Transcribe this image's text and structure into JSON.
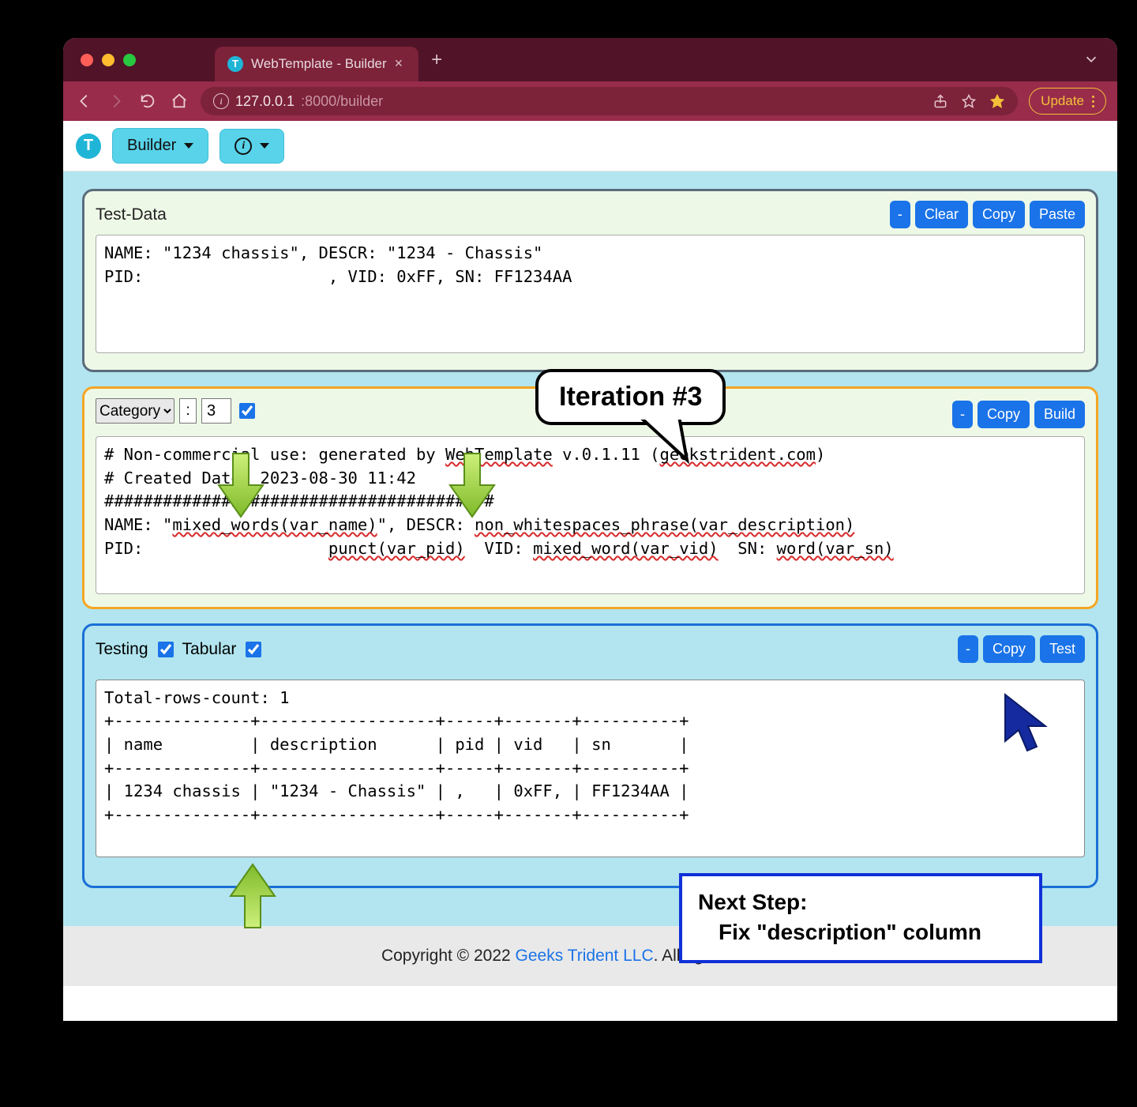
{
  "browser": {
    "tab_title": "WebTemplate - Builder",
    "url_host": "127.0.0.1",
    "url_port_path": ":8000/builder",
    "update_label": "Update"
  },
  "app_toolbar": {
    "builder_label": "Builder"
  },
  "panels": {
    "testdata": {
      "title": "Test-Data",
      "btn_minus": "-",
      "btn_clear": "Clear",
      "btn_copy": "Copy",
      "btn_paste": "Paste",
      "content": "NAME: \"1234 chassis\", DESCR: \"1234 - Chassis\"\nPID:                   , VID: 0xFF, SN: FF1234AA"
    },
    "template": {
      "category_selected": "Category",
      "colon": ":",
      "index": "3",
      "btn_minus": "-",
      "btn_copy": "Copy",
      "btn_build": "Build",
      "line1_a": "# Non-commercial use: generated by ",
      "line1_b": "WebTemplate",
      "line1_c": " v.0.1.11 (",
      "line1_d": "geekstrident.com",
      "line1_e": ")",
      "line2": "# Created Date: 2023-08-30 11:42",
      "line3": "########################################",
      "line4_a": "NAME: \"",
      "line4_b": "mixed_words(var_name)",
      "line4_c": "\", DESCR: ",
      "line4_d": "non_whitespaces_phrase(var_description)",
      "line5_a": "PID:                   ",
      "line5_b": "punct(var_pid)",
      "line5_c": "  VID: ",
      "line5_d": "mixed_word(var_vid)",
      "line5_e": "  SN: ",
      "line5_f": "word(var_sn)"
    },
    "testing": {
      "label_testing": "Testing",
      "label_tabular": "Tabular",
      "btn_minus": "-",
      "btn_copy": "Copy",
      "btn_test": "Test",
      "output": "Total-rows-count: 1\n+--------------+------------------+-----+-------+----------+\n| name         | description      | pid | vid   | sn       |\n+--------------+------------------+-----+-------+----------+\n| 1234 chassis | \"1234 - Chassis\" | ,   | 0xFF, | FF1234AA |\n+--------------+------------------+-----+-------+----------+"
    }
  },
  "annotations": {
    "iteration": "Iteration #3",
    "next_step_l1": "Next Step:",
    "next_step_l2": "Fix \"description\" column"
  },
  "footer": {
    "prefix": "Copyright © 2022 ",
    "link": "Geeks Trident LLC",
    "suffix": ". All rights reserved."
  },
  "chart_data": {
    "type": "table",
    "title": "Total-rows-count: 1",
    "columns": [
      "name",
      "description",
      "pid",
      "vid",
      "sn"
    ],
    "rows": [
      [
        "1234 chassis",
        "\"1234 - Chassis\"",
        ",",
        "0xFF,",
        "FF1234AA"
      ]
    ]
  }
}
